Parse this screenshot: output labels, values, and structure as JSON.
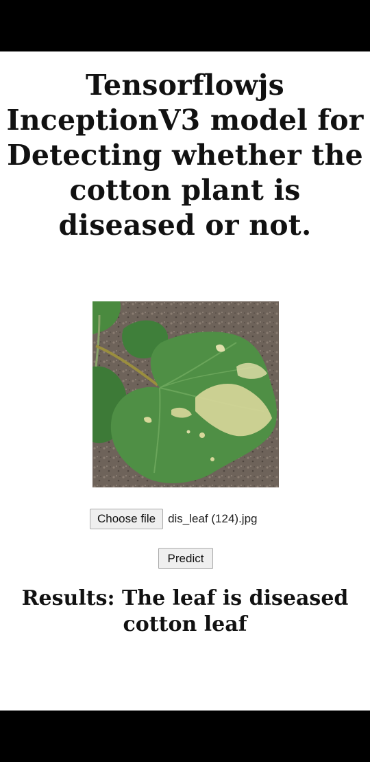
{
  "page": {
    "title": "Tensorflowjs InceptionV3 model for Detecting whether the cotton plant is diseased or not."
  },
  "upload": {
    "choose_label": "Choose file",
    "file_name": "dis_leaf (124).jpg"
  },
  "actions": {
    "predict_label": "Predict"
  },
  "results": {
    "text": "Results: The leaf is diseased cotton leaf"
  },
  "colors": {
    "background": "#ffffff",
    "system_bars": "#000000",
    "button_bg": "#efefef",
    "leaf_green": "#4f8f45",
    "soil": "#6b5f55"
  }
}
